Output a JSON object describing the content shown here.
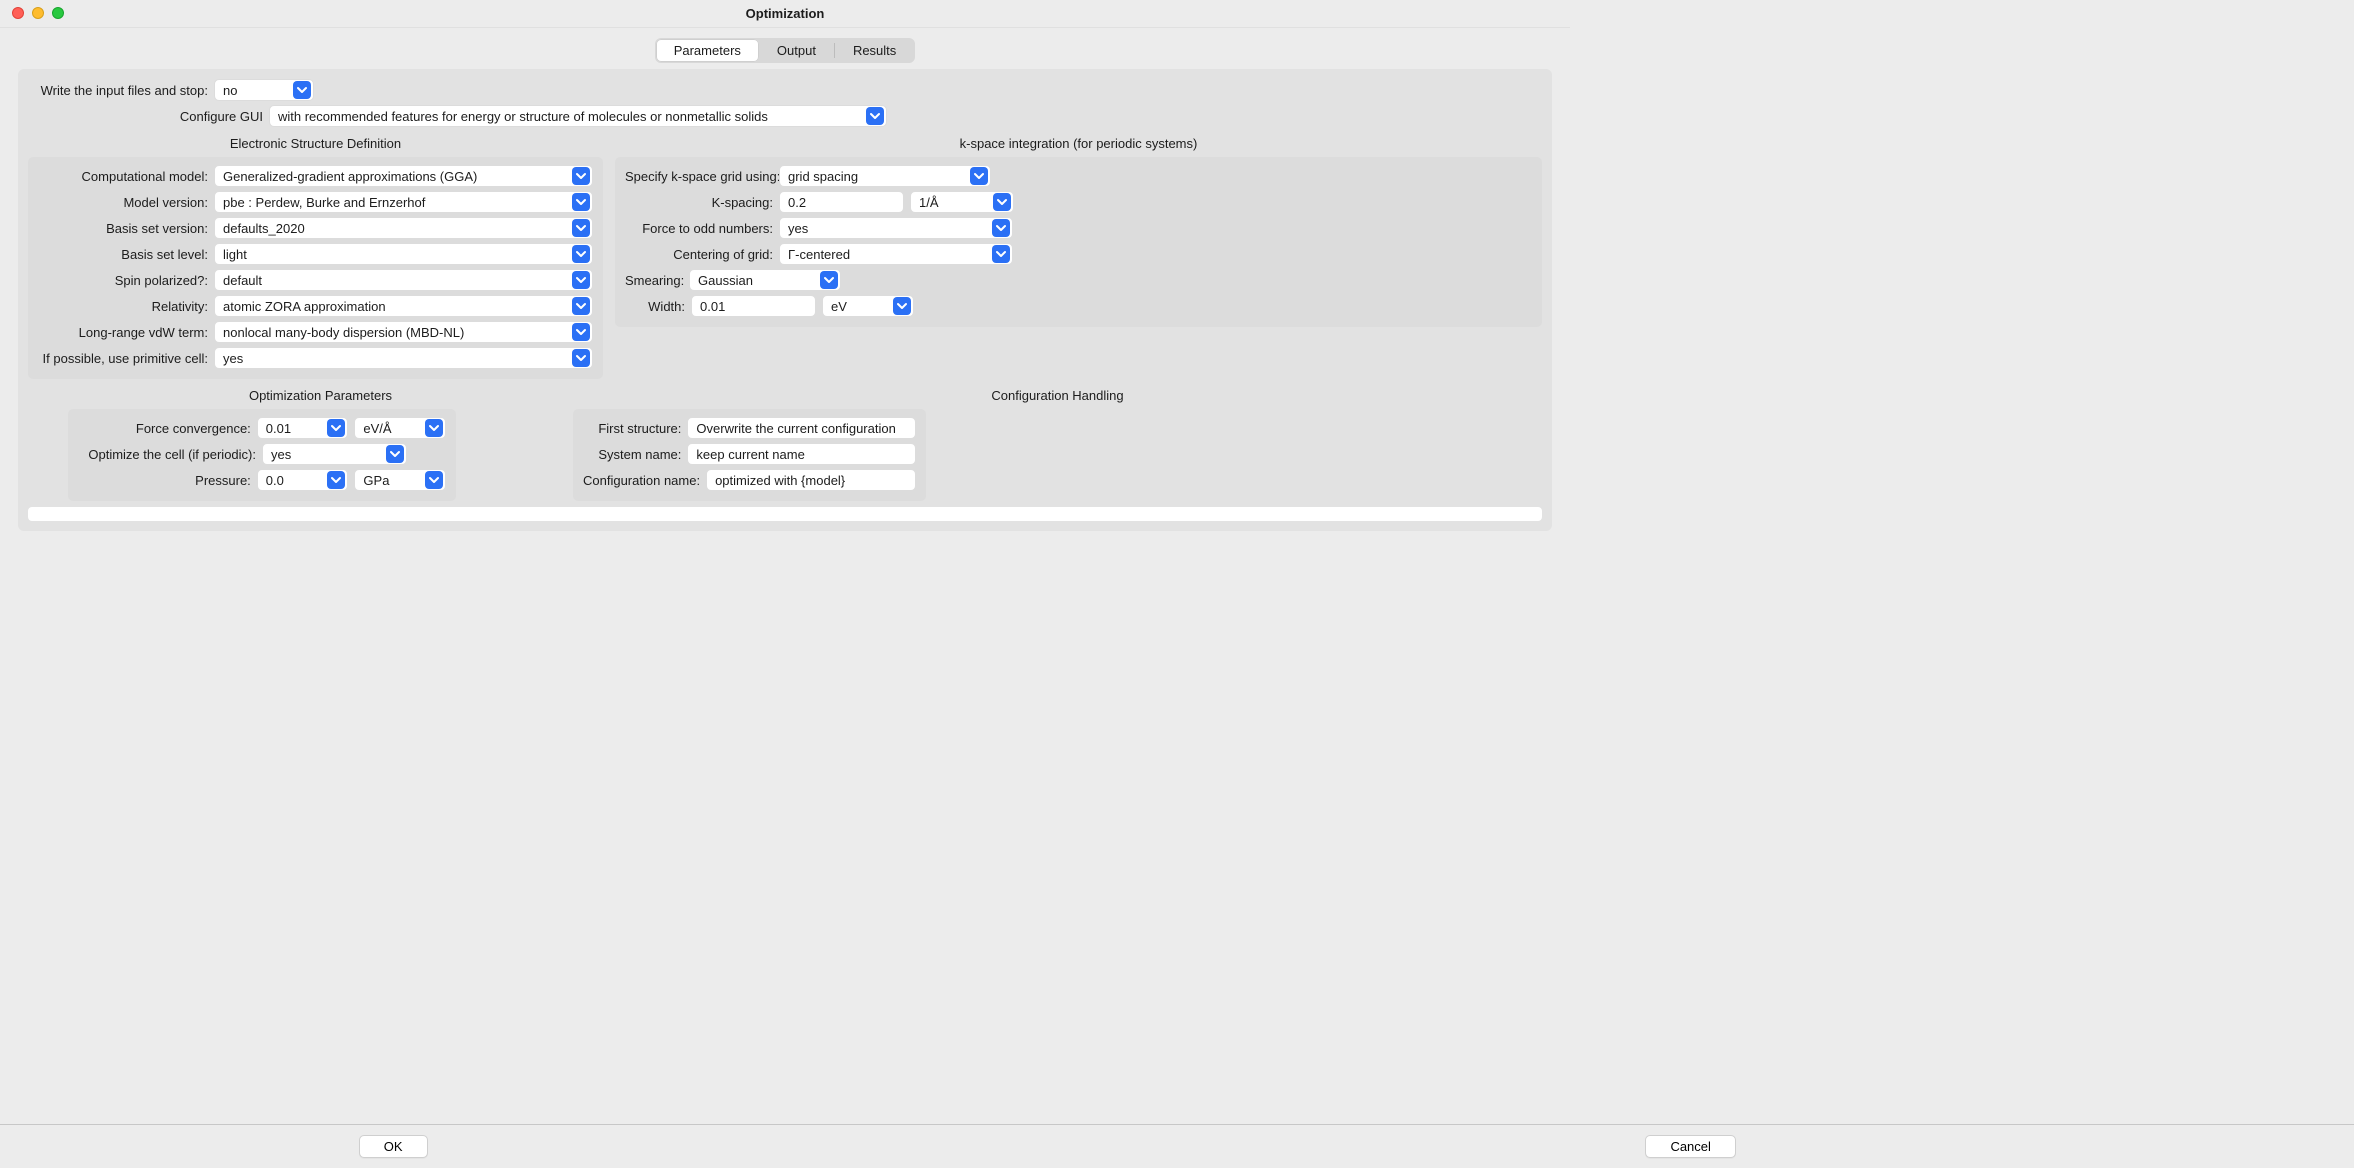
{
  "window": {
    "title": "Optimization"
  },
  "tabs": [
    "Parameters",
    "Output",
    "Results"
  ],
  "active_tab": 0,
  "top": {
    "write_input_label": "Write the input files and stop:",
    "write_input_value": "no",
    "configure_gui_label": "Configure GUI",
    "configure_gui_value": "with recommended features for energy or structure of molecules or nonmetallic solids"
  },
  "esd": {
    "title": "Electronic Structure Definition",
    "rows": {
      "comp_model_label": "Computational model:",
      "comp_model_value": "Generalized-gradient approximations (GGA)",
      "model_version_label": "Model version:",
      "model_version_value": "pbe : Perdew, Burke and Ernzerhof",
      "basis_set_version_label": "Basis set version:",
      "basis_set_version_value": "defaults_2020",
      "basis_set_level_label": "Basis set level:",
      "basis_set_level_value": "light",
      "spin_label": "Spin polarized?:",
      "spin_value": "default",
      "relativity_label": "Relativity:",
      "relativity_value": "atomic ZORA approximation",
      "vdw_label": "Long-range vdW term:",
      "vdw_value": "nonlocal many-body dispersion (MBD-NL)",
      "primcell_label": "If possible, use primitive cell:",
      "primcell_value": "yes"
    }
  },
  "kspace": {
    "title": "k-space integration (for periodic systems)",
    "specify_label": "Specify k-space grid using:",
    "specify_value": "grid spacing",
    "kspacing_label": "K-spacing:",
    "kspacing_value": "0.2",
    "kspacing_unit": "1/Å",
    "force_odd_label": "Force to odd numbers:",
    "force_odd_value": "yes",
    "centering_label": "Centering of grid:",
    "centering_value": "Γ-centered",
    "smearing_label": "Smearing:",
    "smearing_value": "Gaussian",
    "width_label": "Width:",
    "width_value": "0.01",
    "width_unit": "eV"
  },
  "opt": {
    "title": "Optimization Parameters",
    "force_conv_label": "Force convergence:",
    "force_conv_value": "0.01",
    "force_conv_unit": "eV/Å",
    "opt_cell_label": "Optimize the cell (if periodic):",
    "opt_cell_value": "yes",
    "pressure_label": "Pressure:",
    "pressure_value": "0.0",
    "pressure_unit": "GPa"
  },
  "cfg": {
    "title": "Configuration Handling",
    "first_struct_label": "First structure:",
    "first_struct_value": "Overwrite the current configuration",
    "system_name_label": "System name:",
    "system_name_value": "keep current name",
    "config_name_label": "Configuration name:",
    "config_name_value": "optimized with {model}"
  },
  "footer": {
    "ok": "OK",
    "cancel": "Cancel"
  }
}
